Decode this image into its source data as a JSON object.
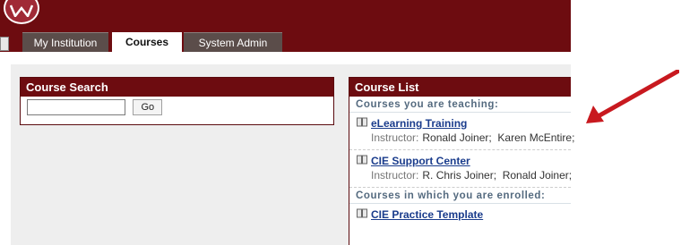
{
  "tabs": [
    {
      "label": "My Institution"
    },
    {
      "label": "Courses"
    },
    {
      "label": "System Admin"
    }
  ],
  "course_search": {
    "title": "Course Search",
    "input_value": "",
    "go_label": "Go"
  },
  "course_list": {
    "title": "Course List",
    "teaching_heading": "Courses you are teaching:",
    "teaching": [
      {
        "name": "eLearning Training",
        "instructor_label": "Instructor:",
        "instructors": "Ronald Joiner;  Karen McEntire;"
      },
      {
        "name": "CIE Support Center",
        "instructor_label": "Instructor:",
        "instructors": "R. Chris Joiner;  Ronald Joiner;"
      }
    ],
    "enrolled_heading": "Courses in which you are enrolled:",
    "enrolled": [
      {
        "name": "CIE Practice Template"
      }
    ]
  },
  "colors": {
    "header": "#6d0c10",
    "tab_inactive": "#5b4d4a",
    "link": "#1a3c8c",
    "arrow": "#c8191f"
  }
}
